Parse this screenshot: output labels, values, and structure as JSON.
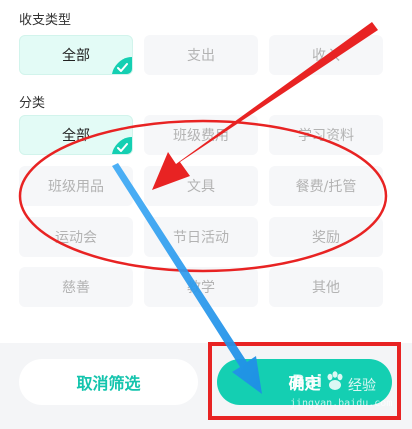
{
  "sections": {
    "type_title": "收支类型",
    "category_title": "分类"
  },
  "type_options": [
    {
      "label": "全部",
      "selected": true
    },
    {
      "label": "支出",
      "selected": false
    },
    {
      "label": "收入",
      "selected": false
    }
  ],
  "category_options": [
    {
      "label": "全部",
      "selected": true
    },
    {
      "label": "班级费用",
      "selected": false
    },
    {
      "label": "学习资料",
      "selected": false
    },
    {
      "label": "班级用品",
      "selected": false
    },
    {
      "label": "文具",
      "selected": false
    },
    {
      "label": "餐费/托管",
      "selected": false
    },
    {
      "label": "运动会",
      "selected": false
    },
    {
      "label": "节日活动",
      "selected": false
    },
    {
      "label": "奖励",
      "selected": false
    },
    {
      "label": "慈善",
      "selected": false
    },
    {
      "label": "教学",
      "selected": false
    },
    {
      "label": "其他",
      "selected": false
    }
  ],
  "footer": {
    "reset_label": "取消筛选",
    "confirm_label": "确定"
  },
  "watermark": {
    "brand": "Bai",
    "text": "经验",
    "url": "jingyan.baidu.com"
  },
  "colors": {
    "accent": "#14cfb2",
    "annotation_red": "#e82323",
    "annotation_blue": "#2b9cf0"
  }
}
